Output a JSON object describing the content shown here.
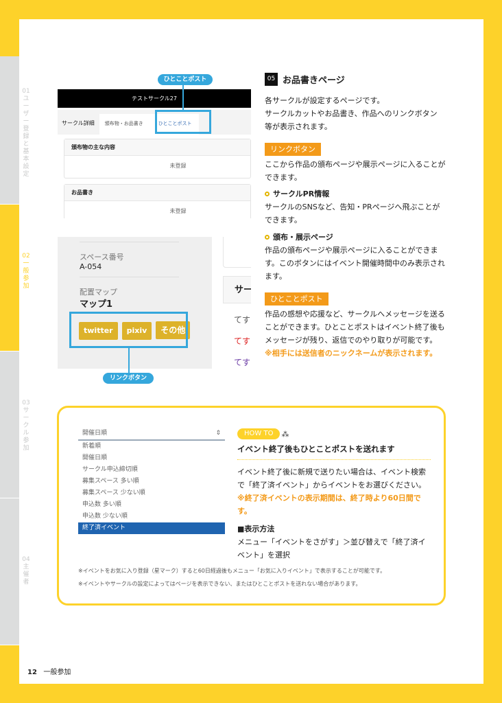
{
  "side_tabs": [
    {
      "num": "01",
      "label": "ユーザー登録と基本設定",
      "active": false
    },
    {
      "num": "02",
      "label": "一般参加",
      "active": true
    },
    {
      "num": "03",
      "label": "サークル参加",
      "active": false
    },
    {
      "num": "04",
      "label": "主催者",
      "active": false
    }
  ],
  "screenshot1": {
    "header_title": "テストサークル27",
    "tabs": [
      "サークル詳細",
      "頒布物・お品書き",
      "ひとことポスト"
    ],
    "cards": [
      {
        "title": "頒布物の主な内容",
        "body": "未登録"
      },
      {
        "title": "お品書き",
        "body": "未登録"
      }
    ],
    "callout": "ひとことポスト"
  },
  "screenshot2": {
    "space_label": "スペース番号",
    "space_value": "A-054",
    "map_label": "配置マップ",
    "map_value": "マップ1",
    "buttons": [
      "twitter",
      "pixiv",
      "その他"
    ],
    "right_heading": "サー",
    "right_lines": [
      "てす",
      "てす",
      "てす"
    ],
    "callout": "リンクボタン"
  },
  "section": {
    "number": "05",
    "title": "お品書きページ",
    "intro": [
      "各サークルが設定するページです。",
      "サークルカットやお品書き、作品へのリンクボタン",
      "等が表示されます。"
    ],
    "link_tag": "リンクボタン",
    "link_desc": "ここから作品の頒布ページや展示ページに入ることができます。",
    "pr_title": "サークルPR情報",
    "pr_desc": "サークルのSNSなど、告知・PRページへ飛ぶことができます。",
    "dist_title": "頒布・展示ページ",
    "dist_desc": "作品の頒布ページや展示ページに入ることができます。このボタンにはイベント開催時間中のみ表示されます。",
    "post_tag": "ひとことポスト",
    "post_desc": "作品の感想や応援など、サークルへメッセージを送ることができます。ひとことポストはイベント終了後もメッセージが残り、返信でのやり取りが可能です。",
    "post_note": "※相手には送信者のニックネームが表示されます。"
  },
  "howto": {
    "select_value": "開催日順",
    "options": [
      "新着順",
      "開催日順",
      "サークル申込締切順",
      "募集スペース 多い順",
      "募集スペース 少ない順",
      "申込数 多い順",
      "申込数 少ない順",
      "終了済イベント"
    ],
    "badge": "HOW TO",
    "title": "イベント終了後もひとことポストを送れます",
    "desc": "イベント終了後に新規で送りたい場合は、イベント検索で「終了済イベント」からイベントをお選びください。",
    "note": "※終了済イベントの表示期間は、終了時より60日間です。",
    "method_title": "■表示方法",
    "method_desc": "メニュー「イベントをさがす」＞並び替えで「終了済イベント」を選択",
    "footnotes": [
      "※イベントをお気に入り登録（星マーク）すると60日経過後もメニュー「お気に入りイベント」で表示することが可能です。",
      "※イベントやサークルの設定によってはページを表示できない、またはひとことポストを送れない場合があります。"
    ]
  },
  "footer": {
    "page": "12",
    "section": "一般参加"
  },
  "colors": {
    "yellow": "#FDD22A",
    "orange": "#F39A19",
    "blue": "#35a7dc",
    "select_blue": "#1f64b0"
  }
}
